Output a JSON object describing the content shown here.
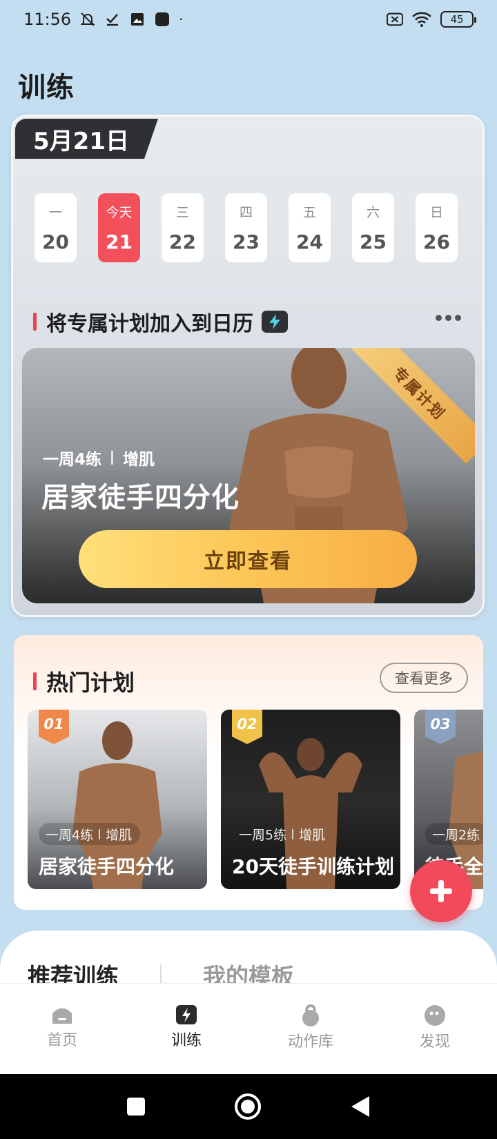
{
  "status_bar": {
    "time": "11:56",
    "battery": "45"
  },
  "page_title": "训练",
  "calendar": {
    "date_label": "5月21日",
    "days": [
      {
        "weekday": "一",
        "date": "20"
      },
      {
        "weekday": "今天",
        "date": "21"
      },
      {
        "weekday": "三",
        "date": "22"
      },
      {
        "weekday": "四",
        "date": "23"
      },
      {
        "weekday": "五",
        "date": "24"
      },
      {
        "weekday": "六",
        "date": "25"
      },
      {
        "weekday": "日",
        "date": "26"
      }
    ],
    "selected_index": 1,
    "add_to_calendar_title": "将专属计划加入到日历"
  },
  "featured_plan": {
    "ribbon": "专属计划",
    "frequency": "一周4练",
    "goal": "增肌",
    "title": "居家徒手四分化",
    "button": "立即查看"
  },
  "hot_plans": {
    "title": "热门计划",
    "more_label": "查看更多",
    "items": [
      {
        "rank": "01",
        "frequency": "一周4练",
        "goal": "增肌",
        "title": "居家徒手四分化"
      },
      {
        "rank": "02",
        "frequency": "一周5练",
        "goal": "增肌",
        "title": "20天徒手训练计划"
      },
      {
        "rank": "03",
        "frequency": "一周2练",
        "goal": "",
        "title": "徒手全"
      }
    ]
  },
  "sheet_tabs": {
    "active": "推荐训练",
    "inactive": "我的模板"
  },
  "tab_bar": [
    {
      "label": "首页",
      "icon": "home-icon"
    },
    {
      "label": "训练",
      "icon": "training-bolt-icon"
    },
    {
      "label": "动作库",
      "icon": "kettlebell-icon"
    },
    {
      "label": "发现",
      "icon": "discover-icon"
    }
  ],
  "colors": {
    "accent": "#f24a5a",
    "today": "#f4505c",
    "button_gold": "#fcc657",
    "background": "#c3def0"
  }
}
